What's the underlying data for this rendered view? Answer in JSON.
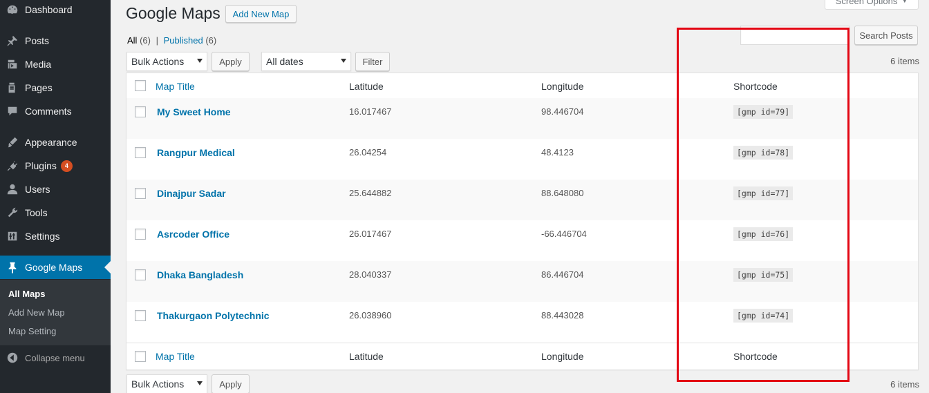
{
  "sidebar": {
    "items": [
      {
        "label": "Dashboard",
        "icon": "dashboard-icon"
      },
      {
        "label": "Posts",
        "icon": "pin-icon"
      },
      {
        "label": "Media",
        "icon": "media-icon"
      },
      {
        "label": "Pages",
        "icon": "pages-icon"
      },
      {
        "label": "Comments",
        "icon": "comment-icon"
      },
      {
        "label": "Appearance",
        "icon": "brush-icon"
      },
      {
        "label": "Plugins",
        "icon": "plug-icon",
        "badge": "4"
      },
      {
        "label": "Users",
        "icon": "user-icon"
      },
      {
        "label": "Tools",
        "icon": "wrench-icon"
      },
      {
        "label": "Settings",
        "icon": "settings-icon"
      },
      {
        "label": "Google Maps",
        "icon": "pushpin-icon",
        "active": true
      }
    ],
    "submenu": [
      "All Maps",
      "Add New Map",
      "Map Setting"
    ],
    "collapse_label": "Collapse menu"
  },
  "header": {
    "title": "Google Maps",
    "add_new_label": "Add New Map",
    "screen_options_label": "Screen Options"
  },
  "filters": {
    "all_label": "All",
    "all_count": "(6)",
    "separator": "|",
    "published_label": "Published",
    "published_count": "(6)"
  },
  "search": {
    "button_label": "Search Posts",
    "value": ""
  },
  "bulk": {
    "bulk_actions": "Bulk Actions",
    "apply": "Apply",
    "all_dates": "All dates",
    "filter": "Filter",
    "items_count": "6 items"
  },
  "table": {
    "columns": [
      "Map Title",
      "Latitude",
      "Longitude",
      "Shortcode"
    ],
    "rows": [
      {
        "title": "My Sweet Home",
        "lat": "16.017467",
        "lng": "98.446704",
        "shortcode": "[gmp id=79]"
      },
      {
        "title": "Rangpur Medical",
        "lat": "26.04254",
        "lng": "48.4123",
        "shortcode": "[gmp id=78]"
      },
      {
        "title": "Dinajpur Sadar",
        "lat": "25.644882",
        "lng": "88.648080",
        "shortcode": "[gmp id=77]"
      },
      {
        "title": "Asrcoder Office",
        "lat": "26.017467",
        "lng": "-66.446704",
        "shortcode": "[gmp id=76]"
      },
      {
        "title": "Dhaka Bangladesh",
        "lat": "28.040337",
        "lng": "86.446704",
        "shortcode": "[gmp id=75]"
      },
      {
        "title": "Thakurgaon Polytechnic",
        "lat": "26.038960",
        "lng": "88.443028",
        "shortcode": "[gmp id=74]"
      }
    ]
  },
  "colors": {
    "sidebar_bg": "#23282d",
    "active_bg": "#0073aa",
    "link": "#0073aa",
    "highlight": "#e30613",
    "badge": "#d54e21"
  }
}
